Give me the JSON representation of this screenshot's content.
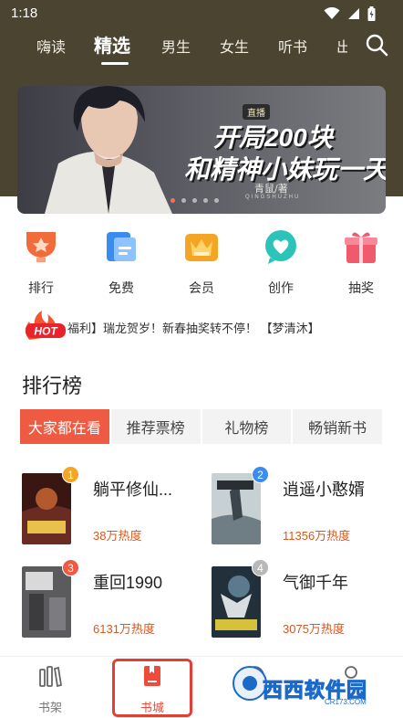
{
  "status_bar": {
    "time": "1:18",
    "icons": [
      "wifi-icon",
      "signal-icon",
      "battery-icon"
    ]
  },
  "top_nav": {
    "tabs": [
      {
        "label": "嗨读"
      },
      {
        "label": "精选"
      },
      {
        "label": "男生"
      },
      {
        "label": "女生"
      },
      {
        "label": "听书"
      },
      {
        "label": "出"
      }
    ],
    "active_index": 1
  },
  "banner": {
    "tag": "直播",
    "line1": "开局200块",
    "line2": "和精神小妹玩一天",
    "author": "青鼠/著",
    "pinyin": "QINGSHUZHU",
    "dots": 5,
    "active_dot": 0
  },
  "quick_links": [
    {
      "label": "排行",
      "icon": "trophy-icon",
      "color": "#f26b3a"
    },
    {
      "label": "免费",
      "icon": "book-free-icon",
      "color": "#3b8cf0"
    },
    {
      "label": "会员",
      "icon": "crown-icon",
      "color": "#f5a524"
    },
    {
      "label": "创作",
      "icon": "heart-chat-icon",
      "color": "#2cc4b8"
    },
    {
      "label": "抽奖",
      "icon": "gift-icon",
      "color": "#f05a6c"
    }
  ],
  "notice": {
    "badge": "HOT",
    "text": "福利】瑞龙贺岁！新春抽奖转不停！    【梦清沐】"
  },
  "ranking": {
    "title": "排行榜",
    "tabs": [
      "大家都在看",
      "推荐票榜",
      "礼物榜",
      "畅销新书"
    ],
    "active_tab": 0,
    "books": [
      {
        "rank": "1",
        "title": "躺平修仙...",
        "heat": "38万热度",
        "badge_color": "#f5a524",
        "cover": "#6a2c22"
      },
      {
        "rank": "2",
        "title": "逍遥小憨婿",
        "heat": "11356万热度",
        "badge_color": "#3b8cf0",
        "cover": "#a9b4b8"
      },
      {
        "rank": "3",
        "title": "重回1990",
        "heat": "6131万热度",
        "badge_color": "#ef5a43",
        "cover": "#5b5b5e"
      },
      {
        "rank": "4",
        "title": "气御千年",
        "heat": "3075万热度",
        "badge_color": "#b8b8b8",
        "cover": "#22303c"
      }
    ]
  },
  "bottom_nav": {
    "items": [
      {
        "label": "书架",
        "icon": "bookshelf-icon"
      },
      {
        "label": "书城",
        "icon": "bookmark-book-icon"
      },
      {
        "label": "",
        "icon": "discover-icon"
      },
      {
        "label": "",
        "icon": "profile-icon"
      }
    ],
    "active_index": 1
  },
  "watermark": {
    "text": "西西软件园",
    "sub": "CR173.COM"
  }
}
